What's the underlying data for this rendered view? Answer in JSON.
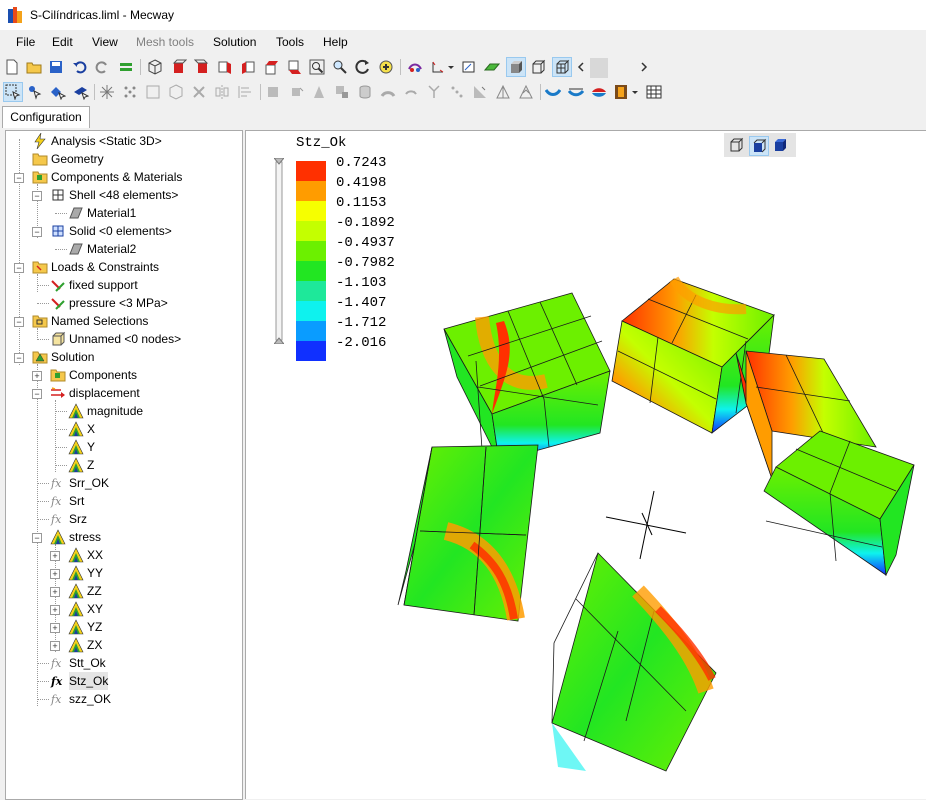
{
  "window": {
    "title": "S-Cilíndricas.liml - Mecway"
  },
  "menu": [
    {
      "label": "File",
      "enabled": true
    },
    {
      "label": "Edit",
      "enabled": true
    },
    {
      "label": "View",
      "enabled": true
    },
    {
      "label": "Mesh tools",
      "enabled": false
    },
    {
      "label": "Solution",
      "enabled": true
    },
    {
      "label": "Tools",
      "enabled": true
    },
    {
      "label": "Help",
      "enabled": true
    }
  ],
  "tab": {
    "label": "Configuration"
  },
  "tree": {
    "analysis": "Analysis <Static 3D>",
    "geometry": "Geometry",
    "components_materials": "Components & Materials",
    "shell": "Shell <48 elements>",
    "material1": "Material1",
    "solid": "Solid <0 elements>",
    "material2": "Material2",
    "loads": "Loads & Constraints",
    "fixed_support": "fixed support",
    "pressure": "pressure <3 MPa>",
    "named_selections": "Named Selections",
    "unnamed": "Unnamed <0 nodes>",
    "solution": "Solution",
    "components": "Components",
    "displacement": "displacement",
    "magnitude": "magnitude",
    "x": "X",
    "y": "Y",
    "z": "Z",
    "srr": "Srr_OK",
    "srt": "Srt",
    "srz": "Srz",
    "stress": "stress",
    "xx": "XX",
    "yy": "YY",
    "zz": "ZZ",
    "xy": "XY",
    "yz": "YZ",
    "zx": "ZX",
    "stt": "Stt_Ok",
    "stz": "Stz_Ok",
    "szz": "szz_OK"
  },
  "legend": {
    "title": "Stz_Ok",
    "values": [
      "0.7243",
      "0.4198",
      "0.1153",
      "-0.1892",
      "-0.4937",
      "-0.7982",
      "-1.103",
      "-1.407",
      "-1.712",
      "-2.016"
    ],
    "colors": [
      "#ff3000",
      "#ff9c00",
      "#f6ff00",
      "#c4ff00",
      "#6cf000",
      "#22e622",
      "#1ee89a",
      "#0ef2ee",
      "#0a9cff",
      "#1030ff"
    ]
  },
  "colors": {
    "selection": "#cce4f7",
    "accent": "#99c9ef"
  }
}
